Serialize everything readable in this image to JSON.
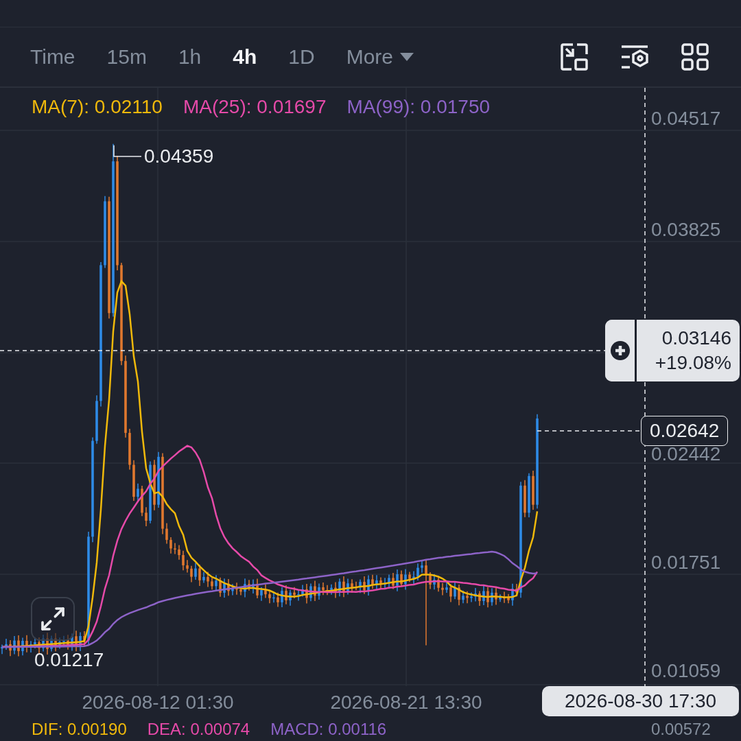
{
  "toolbar": {
    "intervals": [
      {
        "label": "Time",
        "kind": "tab",
        "selected": false
      },
      {
        "label": "15m",
        "kind": "tab",
        "selected": false
      },
      {
        "label": "1h",
        "kind": "tab",
        "selected": false
      },
      {
        "label": "4h",
        "kind": "tab",
        "selected": true
      },
      {
        "label": "1D",
        "kind": "tab",
        "selected": false
      },
      {
        "label": "More",
        "kind": "dropdown",
        "selected": false
      }
    ]
  },
  "indicators": [
    {
      "label": "MA(7): 0.02110",
      "color": "#f0b90b"
    },
    {
      "label": "MA(25): 0.01697",
      "color": "#e64aa9"
    },
    {
      "label": "MA(99): 0.01750",
      "color": "#8d63c8"
    }
  ],
  "chart": {
    "price_labels": [
      "0.04517",
      "0.03825",
      "0.02442",
      "0.01751",
      "0.01059"
    ],
    "high_label": "0.04359",
    "low_label": "0.01217",
    "crosshair": {
      "price": "0.03146",
      "change": "+19.08%",
      "time": "2026-08-30 17:30"
    },
    "last_price": "0.02642",
    "time_labels": [
      "2026-08-12 01:30",
      "2026-08-21 13:30"
    ]
  },
  "macd": {
    "items": [
      {
        "label": "DIF: 0.00190",
        "color": "#f0b90b"
      },
      {
        "label": "DEA: 0.00074",
        "color": "#e64aa9"
      },
      {
        "label": "MACD: 0.00116",
        "color": "#8d63c8"
      }
    ],
    "axis_label": "0.00572"
  }
}
